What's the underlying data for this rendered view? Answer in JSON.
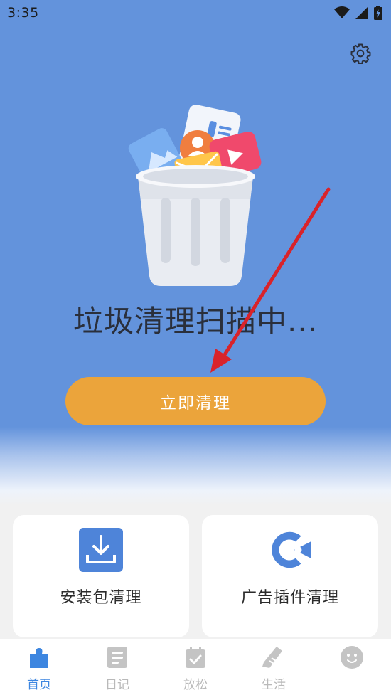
{
  "status_bar": {
    "time": "3:35"
  },
  "hero": {
    "scan_title": "垃圾清理扫描中...",
    "clean_button_label": "立即清理"
  },
  "cards": [
    {
      "label": "安装包清理",
      "icon": "download-tray-icon"
    },
    {
      "label": "广告插件清理",
      "icon": "ad-plugin-icon"
    }
  ],
  "bottom_nav": [
    {
      "label": "首页",
      "icon": "home-puzzle-icon",
      "active": true
    },
    {
      "label": "日记",
      "icon": "diary-icon",
      "active": false
    },
    {
      "label": "放松",
      "icon": "calendar-check-icon",
      "active": false
    },
    {
      "label": "生活",
      "icon": "sneaker-icon",
      "active": false
    },
    {
      "label": "",
      "icon": "face-icon",
      "active": false
    }
  ],
  "colors": {
    "hero_blue": "#6393dc",
    "button_orange": "#eba43b",
    "nav_active": "#3d86e0",
    "nav_inactive": "#b9b9b9",
    "arrow_red": "#d9232a"
  }
}
